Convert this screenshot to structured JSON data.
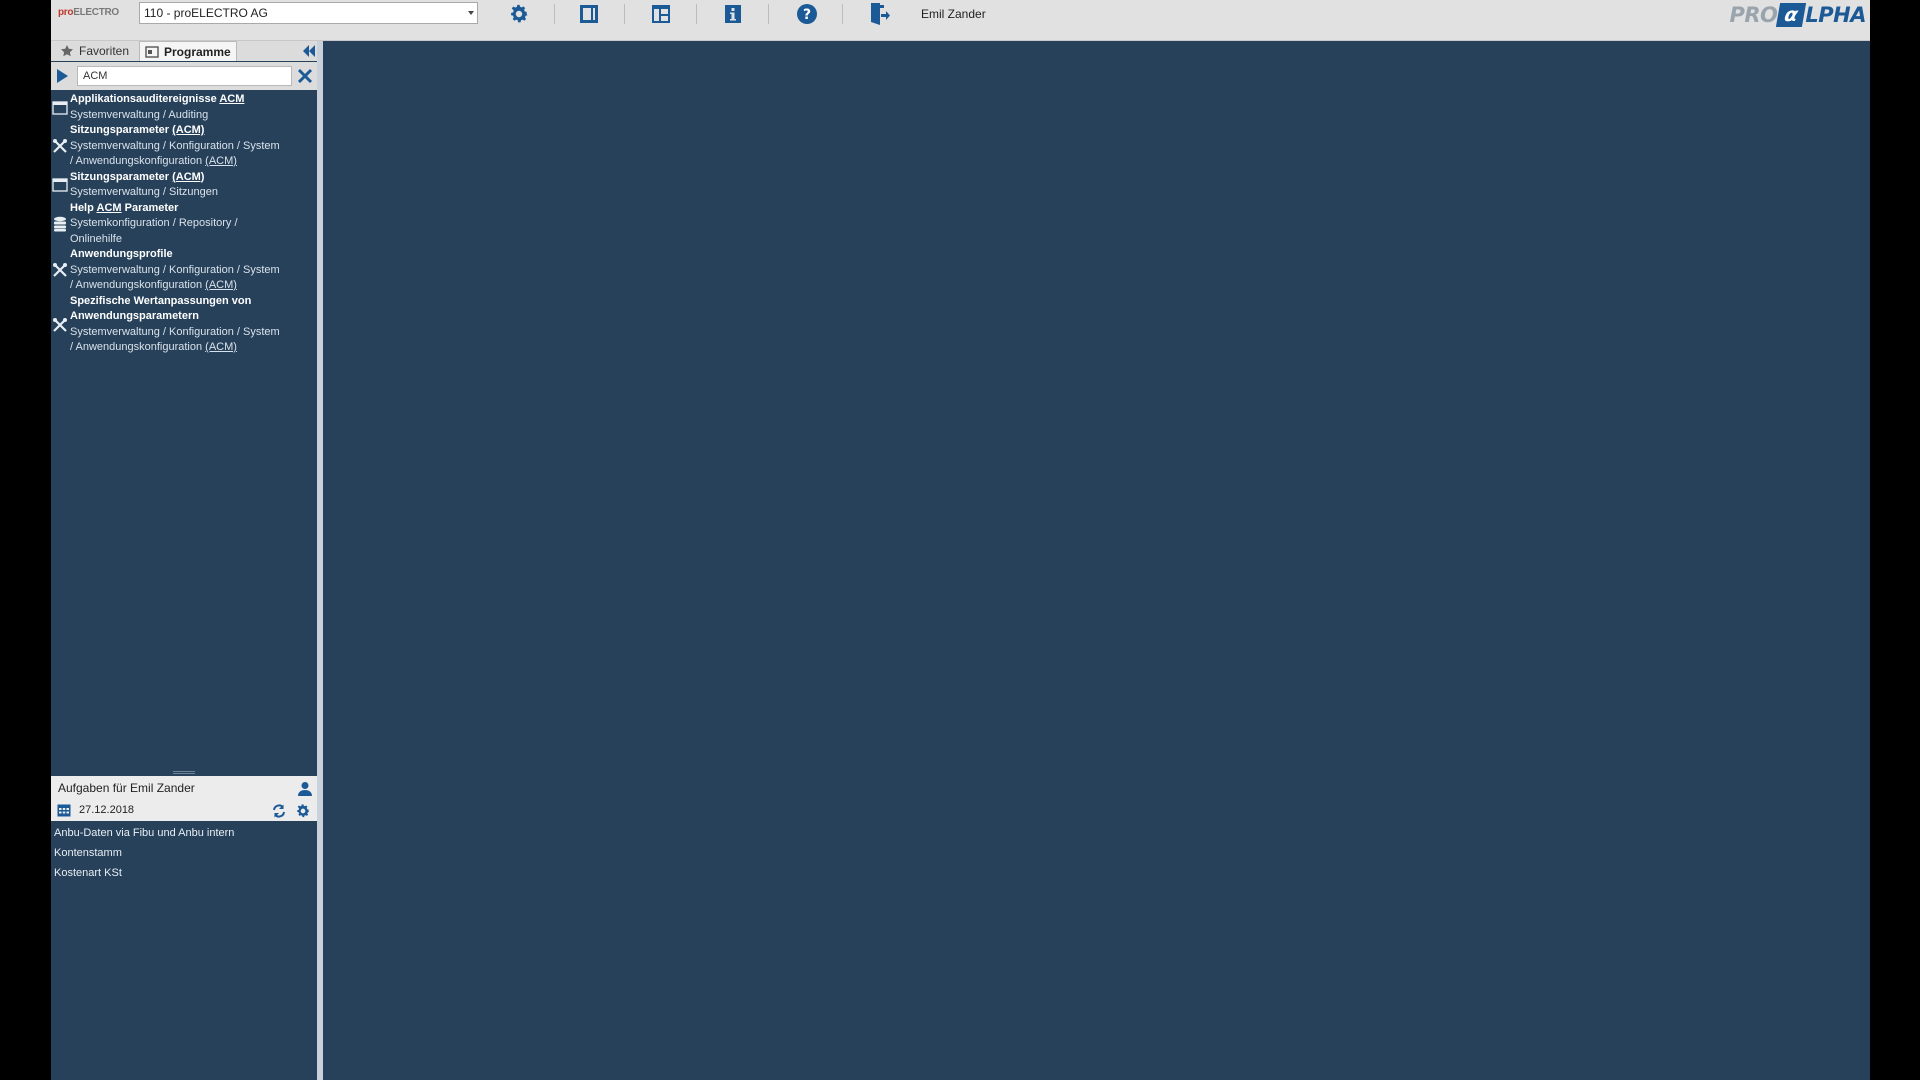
{
  "topbar": {
    "logo_text_pro": "pro",
    "logo_text_rest": "ELECTRO",
    "client_select_value": "110 - proELECTRO AG",
    "user_name": "Emil Zander",
    "brand_pre": "PRO",
    "brand_alpha": "α",
    "brand_post": "LPHA",
    "icons": [
      "gear-icon",
      "single-panel-icon",
      "layout-icon",
      "info-icon",
      "help-icon",
      "logout-icon"
    ]
  },
  "left_panel": {
    "tabs": [
      {
        "label": "Favoriten",
        "icon": "star-icon"
      },
      {
        "label": "Programme",
        "icon": "programs-icon",
        "active": true
      }
    ],
    "search": {
      "value": "ACM"
    },
    "results": [
      {
        "icon": "window-icon",
        "title_parts": [
          "Applikationsauditereignisse ",
          "ACM",
          ""
        ],
        "path_lines": [
          [
            "Systemverwaltung / Auditing",
            "",
            ""
          ]
        ]
      },
      {
        "icon": "tools-icon",
        "title_parts": [
          "Sitzungsparameter ",
          "(ACM)",
          ""
        ],
        "path_lines": [
          [
            "Systemverwaltung / Konfiguration / System",
            "",
            ""
          ],
          [
            "/ Anwendungskonfiguration ",
            "(ACM)",
            ""
          ]
        ]
      },
      {
        "icon": "window-icon",
        "title_parts": [
          "Sitzungsparameter ",
          "(ACM)",
          ""
        ],
        "path_lines": [
          [
            "Systemverwaltung / Sitzungen",
            "",
            ""
          ]
        ]
      },
      {
        "icon": "database-icon",
        "title_parts": [
          "Help ",
          "ACM",
          " Parameter"
        ],
        "path_lines": [
          [
            "Systemkonfiguration / Repository /",
            "",
            ""
          ],
          [
            "Onlinehilfe",
            "",
            ""
          ]
        ]
      },
      {
        "icon": "tools-icon",
        "title_parts": [
          "Anwendungsprofile",
          "",
          ""
        ],
        "path_lines": [
          [
            "Systemverwaltung / Konfiguration / System",
            "",
            ""
          ],
          [
            "/ Anwendungskonfiguration ",
            "(ACM)",
            ""
          ]
        ]
      },
      {
        "icon": "tools-icon",
        "title_parts": [
          "Spezifische Wertanpassungen von Anwendungsparametern",
          "",
          ""
        ],
        "path_lines": [
          [
            "Systemverwaltung / Konfiguration / System",
            "",
            ""
          ],
          [
            "/ Anwendungskonfiguration ",
            "(ACM)",
            ""
          ]
        ]
      }
    ]
  },
  "tasks": {
    "title": "Aufgaben für Emil Zander",
    "date": "27.12.2018",
    "items": [
      "Anbu-Daten via Fibu und Anbu intern",
      "Kontenstamm",
      "Kostenart KSt"
    ]
  },
  "colors": {
    "workspace": "#27415a",
    "toolbar": "#e1e1e1",
    "accent": "#1b5a97"
  }
}
